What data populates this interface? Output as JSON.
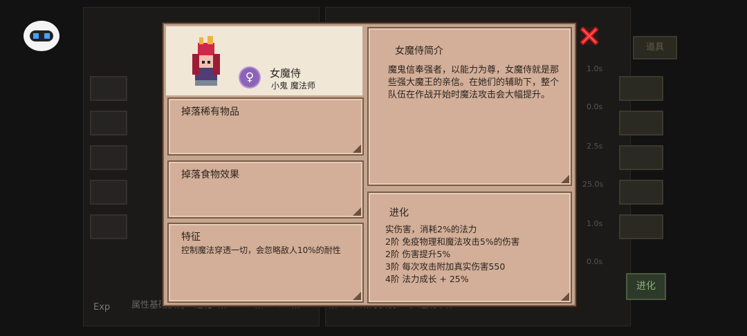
{
  "background": {
    "bottom_text": "属性基础获得：进化1阶+1、2阶+2、3阶+2、4阶+3，成为获友+3，达成单体+2",
    "exp_label": "Exp",
    "right_label_items": "道具",
    "right_label_evolve": "进化",
    "times": [
      "1.0s",
      "0.0s",
      "2.5s",
      "25.0s",
      "1.0s",
      "0.0s"
    ]
  },
  "character": {
    "name": "女魔侍",
    "subtitle": "小鬼 魔法师",
    "gender_icon": "female-icon",
    "gender_symbol": "♀"
  },
  "cards": {
    "drop_rare_title": "掉落稀有物品",
    "drop_food_title": "掉落食物效果",
    "feature_title": "特征",
    "feature_body": "控制魔法穿透一切，会忽略敌人10%的耐性",
    "intro_title": "女魔侍简介",
    "intro_body": "魔鬼信奉强者，以能力为尊，女魔侍就是那些强大魔王的亲信。在她们的辅助下，整个队伍在作战开始时魔法攻击会大幅提升。",
    "evolve_title": "进化",
    "evolve_lines": [
      "实伤害，消耗2%的法力",
      "2阶 免疫物理和魔法攻击5%的伤害",
      "2阶 伤害提升5%",
      "3阶 每次攻击附加真实伤害550",
      "4阶 法力成长 + 25%"
    ]
  },
  "colors": {
    "modal_bg": "#c4a690",
    "card_bg": "#d3ae98",
    "header_bg": "#f0e7d7",
    "close_red": "#d61f1f",
    "gender_purple": "#8c63b7"
  }
}
